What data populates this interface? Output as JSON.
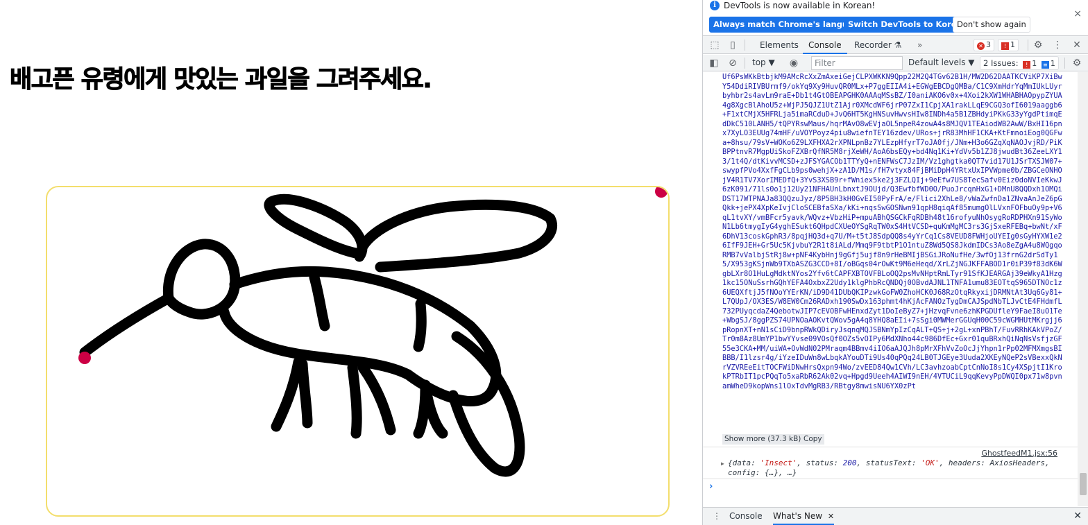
{
  "page": {
    "heading": "배고픈 유령에게 맛있는 과일을 그려주세요."
  },
  "canvas": {
    "frame_color": "#f3de6c",
    "stroke_color": "#000000",
    "marker_color": "#cc0044",
    "content": "hand-drawn insect sketch"
  },
  "devtools": {
    "infobar": {
      "message": "DevTools is now available in Korean!",
      "btn_match": "Always match Chrome's language",
      "btn_switch": "Switch DevTools to Korean",
      "btn_dismiss": "Don't show again",
      "close": "×"
    },
    "tabs": [
      "Elements",
      "Console",
      "Recorder ⚗"
    ],
    "active_tab": "Console",
    "more_tabs": "»",
    "error_count": "3",
    "warning_count": "1",
    "toolbar": {
      "context": "top ▼",
      "filter_placeholder": "Filter",
      "levels": "Default levels ▼",
      "issues_label": "2 Issues:",
      "issues_err": "1",
      "issues_info": "1"
    },
    "log": {
      "base64": "Uf6PsWKkBtbjkM9AMcRcXxZmAxeiGejCLPXWKKN9Qpp22M2Q4TGv62B1H/MW2D62DAATKCViKP7XiBwY54DdiRIVBUrmf9/okYq9Xy9HuvQR0MLx+P7ggEIIA4i+EGWgEBCDgQMBa/C1C9XmHdrYqMmIUkLUyrbyhbr2s4avLm9raE+Db1t4GtOBEAPGHK0AAAqMSsBZ/I0aniAKO6v0x+4Xoi2kXW1WHABHAOpypZYUA4g8XgcBlAhoU5z+WjPJ5QJZ1UtZ1Ajr0XMcdWF6jrP07ZxI1CpjXA1rakLLqE9CGQ3ofI6019aaggb6+F1xtCMjX5HFRLja5imaRCduD+JvQ6HT5KgHNSuvHwvsHIw8INDh4a5B1ZBHdyiPKkG33yYgdPtimqEdDkC510LANH5/tQPYRswMaus/hqrMAvO8wEVjaOL5npeR4zowA4s8MJQV1TEAiodWB2AwW/BxHI16pnx7XyLO3EUUg74mHF/uVOYPoyz4piu8wiefnTEY16zdev/URos+jrR83MhHF1CKA+KtFmnoiEog0QGFwa+8hsu/79sV+WOKo6Z9LXFHXA2rXPNLpnBz7YLEzpHfyrT7oJA0fj/JNm+H3o6GZqXqNAOJvjRD/PiKBPPtnvR7MgpUiSkoFZXBrQfNR5M8rjXeWH/AoA6bsEQy+bd4Nq1Ki+YdVv5b1ZJ8jwudBt36ZeeLXY13/1t4Q/dtKivvMCSD+zJFSYGACOb1TTYyQ+nENFWsC7JzIM/Vz1ghgtka0QT7vid17U1JSrTXSJW07+swypfPVo4XxfFgCLb9ps0wehjX+zA1D/M1s/fH7vtyx84FjBMiDpH4YRtxUxIPVWpme0b/ZBGCeONHOjV4R1TV7XorIMEDfQ+3YvS3XSB9r+fWniex5ke2j3FZLQIj+9eEfw7US8TecSafv0Eiz0doNVIeKkwJ6zK091/71ls0o1j12Uy21NFHAUnLbnxtJ9OUjd/Q3EwfbfWD0O/PuoJrcqnHxG1+DMnU8QQDxh1OMQiDST17WTPNAJa83QQzuJyz/8P5BH3kH0GvEI50PyFrA/e/Flici2XhLe8/vWaZwfnDa1ZNvaAnJeZ6pGQkk+jePX4XpKeIvjCloSCEBfaSXa/kKi+nqsSwGOSNwn91qpH8qiqAf85mumgOlLVxnFOFbuOy9p+V6qL1tvXY/vmBFcr5yavk/WQvz+VbzHiP+mpuABhQSGCkFqRDBh48t16rofyuNhOsygRoRDPHXn91SyWoN1Lb6tmygIyG4yghESukt6QHpdCXUeOYSgRqTW0xS4HtVCSD+quKmMgMC3rs3GjSxeRFEBq+bwNt/xF6DhV13coskGphR3/8pqjHQ3d+q7U/M+t5tJ8SdpQQ8s4yYrCq1Cs8VEUD8FWHjoUYEIg0sGyHYXW1e26IfF9JEH+Gr5Uc5KjvbuY2R1t8iALd/Mmq9F9tbtP1O1ntuZ8Wd5QS8JkdmIDCs3Ao8eZgA4u8WQgqoRMB7vValbjStRj8w+pNF4KybHnj9gGfj5ujf8n9rHeBMIjBSGiJRoNufHe/3wfOj13frnG2drSdTy15/X953gKSjnWb9TXbASZG3CCD+8I/oBGqs04rOwKt9M6eHeqd/XrLZjNGJKFFABOD1r0iP39f83dK6WgbLXr8O1HuLgMdktNYos2Yfv6tCAPFXBTOVFBLoOQ2psMvNHptRmLTyr91SfKJEARGAj39eWkyA1Hzg1kc15ONuSsrhGQhYEFA4OxbxZ2Udy1klgPhbRcQNDQj0OBvdAJNL1TNFA1umu83EOTtqS965DTNOc1z6UEQXftjJ5fNOoYYErKN/iD9D41DUbQKIPzwkGoFW0ZhoHCK0J68RzOtqRkyxijDRMNtAt3Uq6Gy81+L7QUpJ/OX3ES/W8EW0Cm26RADxh190SwDx163phmt4hKjAcFANOzTygDmCAJSpdNbTLJvCtE4FHdmfL732PUyqcdaZ4QebotwJIP7cEVOBFwHEnxdZyt1DoIeByZ7+jHzvqFvne6zhKPGDUfleY9FaeI8uO1Te+WbgSJ/8ggPZS74UPNOaAOKvtQWov5gA4q8YHQ8aEIi+7sSgi0MWMerGGUqH00C59cWGMHUtMKrgjj6pRopnXT+nN1sCiD9bnpRWkQDiryJsqnqMQJSBNmYpIzCqALT+QS+j+2gL+xnPBhT/FuvRRhKAkVPoZ/Tr0m8Az8UmYP1bwYYvse09VOsQf0OZs5vOIPy6MdXNho44c986DfEc+Gxr01quBRxhQiNqNsVsfjzGF55e3CKA+MM/uiWA+OvWdN02PMraqm4BBmv4iIO6aAJQJh8pMrXFhVvZoOcJjYhpn1rPp02MFMXmgsBIBBB/I1lzsr4g/iYzeIDuWn8wLbqkAYouDTi9Us40qPQq24LB0TJGEye3Uuda2XKEyNQeP2sVBexxQkNrVZVREeEitTOCFWiDNwHrsQxpn94Wo/zvEED84Qw1CVh/LC3avhzoabCptCnNoI8s1Cy4XSpjtI1KrokPTRbIT1pcPQqTo5xaRbR62Ak02vq+Hpgd9Ueeh4AIWI9nEH/4VTUCiL9qqKevyPpDWQI0px71w8pvnamWheD9kopWns1lOxTdvMgRB3/RBtgy8mwisNU6YX0zPt",
      "show_more": "Show more (37.3 kB)",
      "copy": "Copy",
      "source": "GhostfeedM1.jsx:56",
      "obj_prefix": "{data: ",
      "obj_data": "'Insect'",
      "obj_mid1": ", status: ",
      "obj_status": "200",
      "obj_mid2": ", statusText: ",
      "obj_statustext": "'OK'",
      "obj_suffix": ", headers: AxiosHeaders, config: {…}, …}",
      "prompt": "›"
    },
    "drawer": {
      "dots": "⋮",
      "tab_console": "Console",
      "tab_whatsnew": "What's New",
      "tab_close": "✕",
      "close": "✕"
    }
  }
}
